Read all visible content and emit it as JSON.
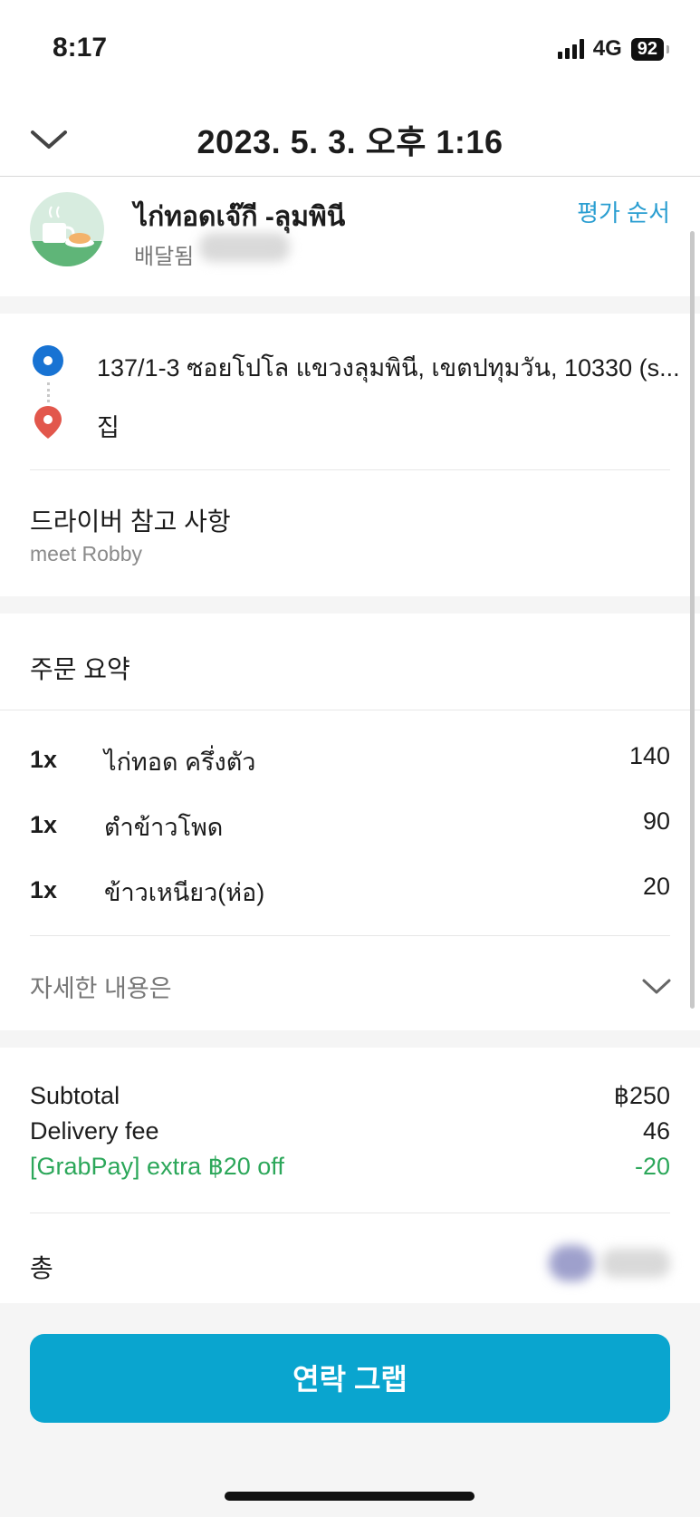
{
  "status_bar": {
    "time": "8:17",
    "network": "4G",
    "battery": "92"
  },
  "header": {
    "title": "2023. 5. 3. 오후 1:16"
  },
  "merchant": {
    "name": "ไก่ทอดเจ๊กี -ลุมพินี",
    "status": "배달됨",
    "rate_label": "평가 순서"
  },
  "route": {
    "pickup_address": "137/1-3 ซอยโปโล แขวงลุมพินี, เขตปทุมวัน, 10330 (s...",
    "dropoff_label": "집"
  },
  "driver_note": {
    "title": "드라이버 참고 사항",
    "text": "meet Robby"
  },
  "order_summary": {
    "title": "주문 요약",
    "items": [
      {
        "qty": "1x",
        "name": "ไก่ทอด ครึ่งตัว",
        "price": "140"
      },
      {
        "qty": "1x",
        "name": "ตำข้าวโพด",
        "price": "90"
      },
      {
        "qty": "1x",
        "name": "ข้าวเหนียว(ห่อ)",
        "price": "20"
      }
    ],
    "details_label": "자세한 내용은"
  },
  "totals": {
    "subtotal_label": "Subtotal",
    "subtotal_value": "฿250",
    "delivery_label": "Delivery fee",
    "delivery_value": "46",
    "promo_label": "[GrabPay] extra ฿20 off",
    "promo_value": "-20",
    "total_label": "총"
  },
  "contact_button": "연락 그랩",
  "colors": {
    "accent": "#0aa5cf",
    "link": "#2a9ed1",
    "discount": "#2ca75a",
    "origin_dot": "#1873d3",
    "destination_pin": "#e2574c"
  },
  "icons": [
    "chevron-down-icon",
    "signal-icon",
    "battery-icon",
    "origin-dot-icon",
    "location-pin-icon"
  ]
}
